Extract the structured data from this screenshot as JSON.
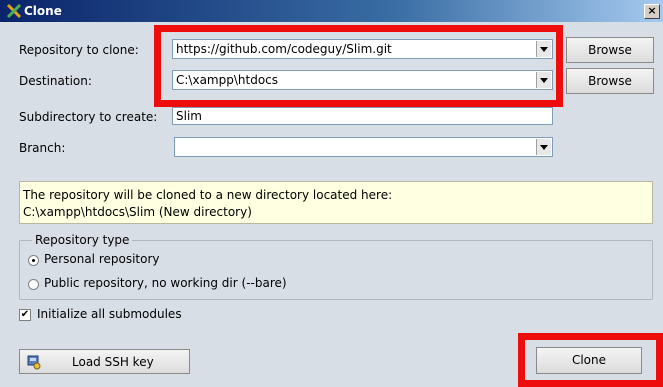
{
  "window": {
    "title": "Clone",
    "close_glyph": "×"
  },
  "form": {
    "repository": {
      "label": "Repository to clone:",
      "value": "https://github.com/codeguy/Slim.git",
      "browse_label": "Browse"
    },
    "destination": {
      "label": "Destination:",
      "value": "C:\\xampp\\htdocs",
      "browse_label": "Browse"
    },
    "subdirectory": {
      "label": "Subdirectory to create:",
      "value": "Slim"
    },
    "branch": {
      "label": "Branch:",
      "value": ""
    }
  },
  "info": {
    "line1": "The repository will be cloned to a new directory located here:",
    "line2": "C:\\xampp\\htdocs\\Slim (New directory)"
  },
  "repo_type": {
    "legend": "Repository type",
    "options": [
      {
        "label": "Personal repository",
        "selected": true
      },
      {
        "label": "Public repository, no working dir  (--bare)",
        "selected": false
      }
    ]
  },
  "init_submodules": {
    "label": "Initialize all submodules",
    "checked": true
  },
  "buttons": {
    "load_ssh_key": "Load SSH key",
    "clone": "Clone"
  },
  "colors": {
    "highlight": "#ee0d0d",
    "info_bg": "#ffffe1"
  }
}
